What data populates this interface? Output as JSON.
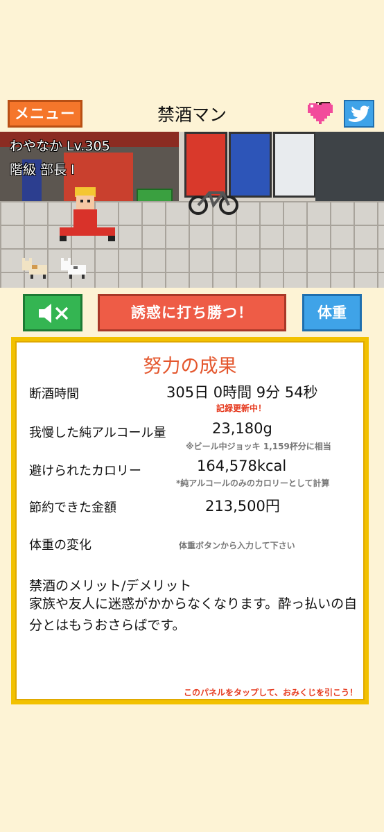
{
  "header": {
    "menu_label": "メニュー",
    "title": "禁酒マン",
    "heart_icon": "heart-icon",
    "twitter_icon": "twitter-bird-icon"
  },
  "scene": {
    "player_name": "わやなか Lv.305",
    "player_rank": "階級 部長 I"
  },
  "actions": {
    "mute_icon": "speaker-muted-icon",
    "resist_label": "誘惑に打ち勝つ！",
    "weight_label": "体重"
  },
  "panel": {
    "title": "努力の成果",
    "abstinence": {
      "label": "断酒時間",
      "value": "305日 0時間 9分 54秒",
      "note": "記録更新中！"
    },
    "alcohol": {
      "label": "我慢した純アルコール量",
      "value": "23,180g",
      "note": "※ビール中ジョッキ 1,159杯分に相当"
    },
    "calories": {
      "label": "避けられたカロリー",
      "value": "164,578kcal",
      "note": "*純アルコールのみのカロリーとして計算"
    },
    "money": {
      "label": "節約できた金額",
      "value": "213,500円"
    },
    "weight": {
      "label": "体重の変化",
      "note": "体重ボタンから入力して下さい"
    },
    "merit": {
      "label": "禁酒のメリット/デメリット",
      "text": "家族や友人に迷惑がかからなくなります。酔っ払いの自分とはもうおさらばです。"
    },
    "footer": "このパネルをタップして、おみくじを引こう！"
  },
  "colors": {
    "background": "#fdf3d5",
    "menu_orange": "#f5762b",
    "resist_red": "#ee5c46",
    "mute_green": "#34b552",
    "weight_blue": "#3fa3e8",
    "panel_border": "#f2c100",
    "title_red": "#e4572e"
  }
}
